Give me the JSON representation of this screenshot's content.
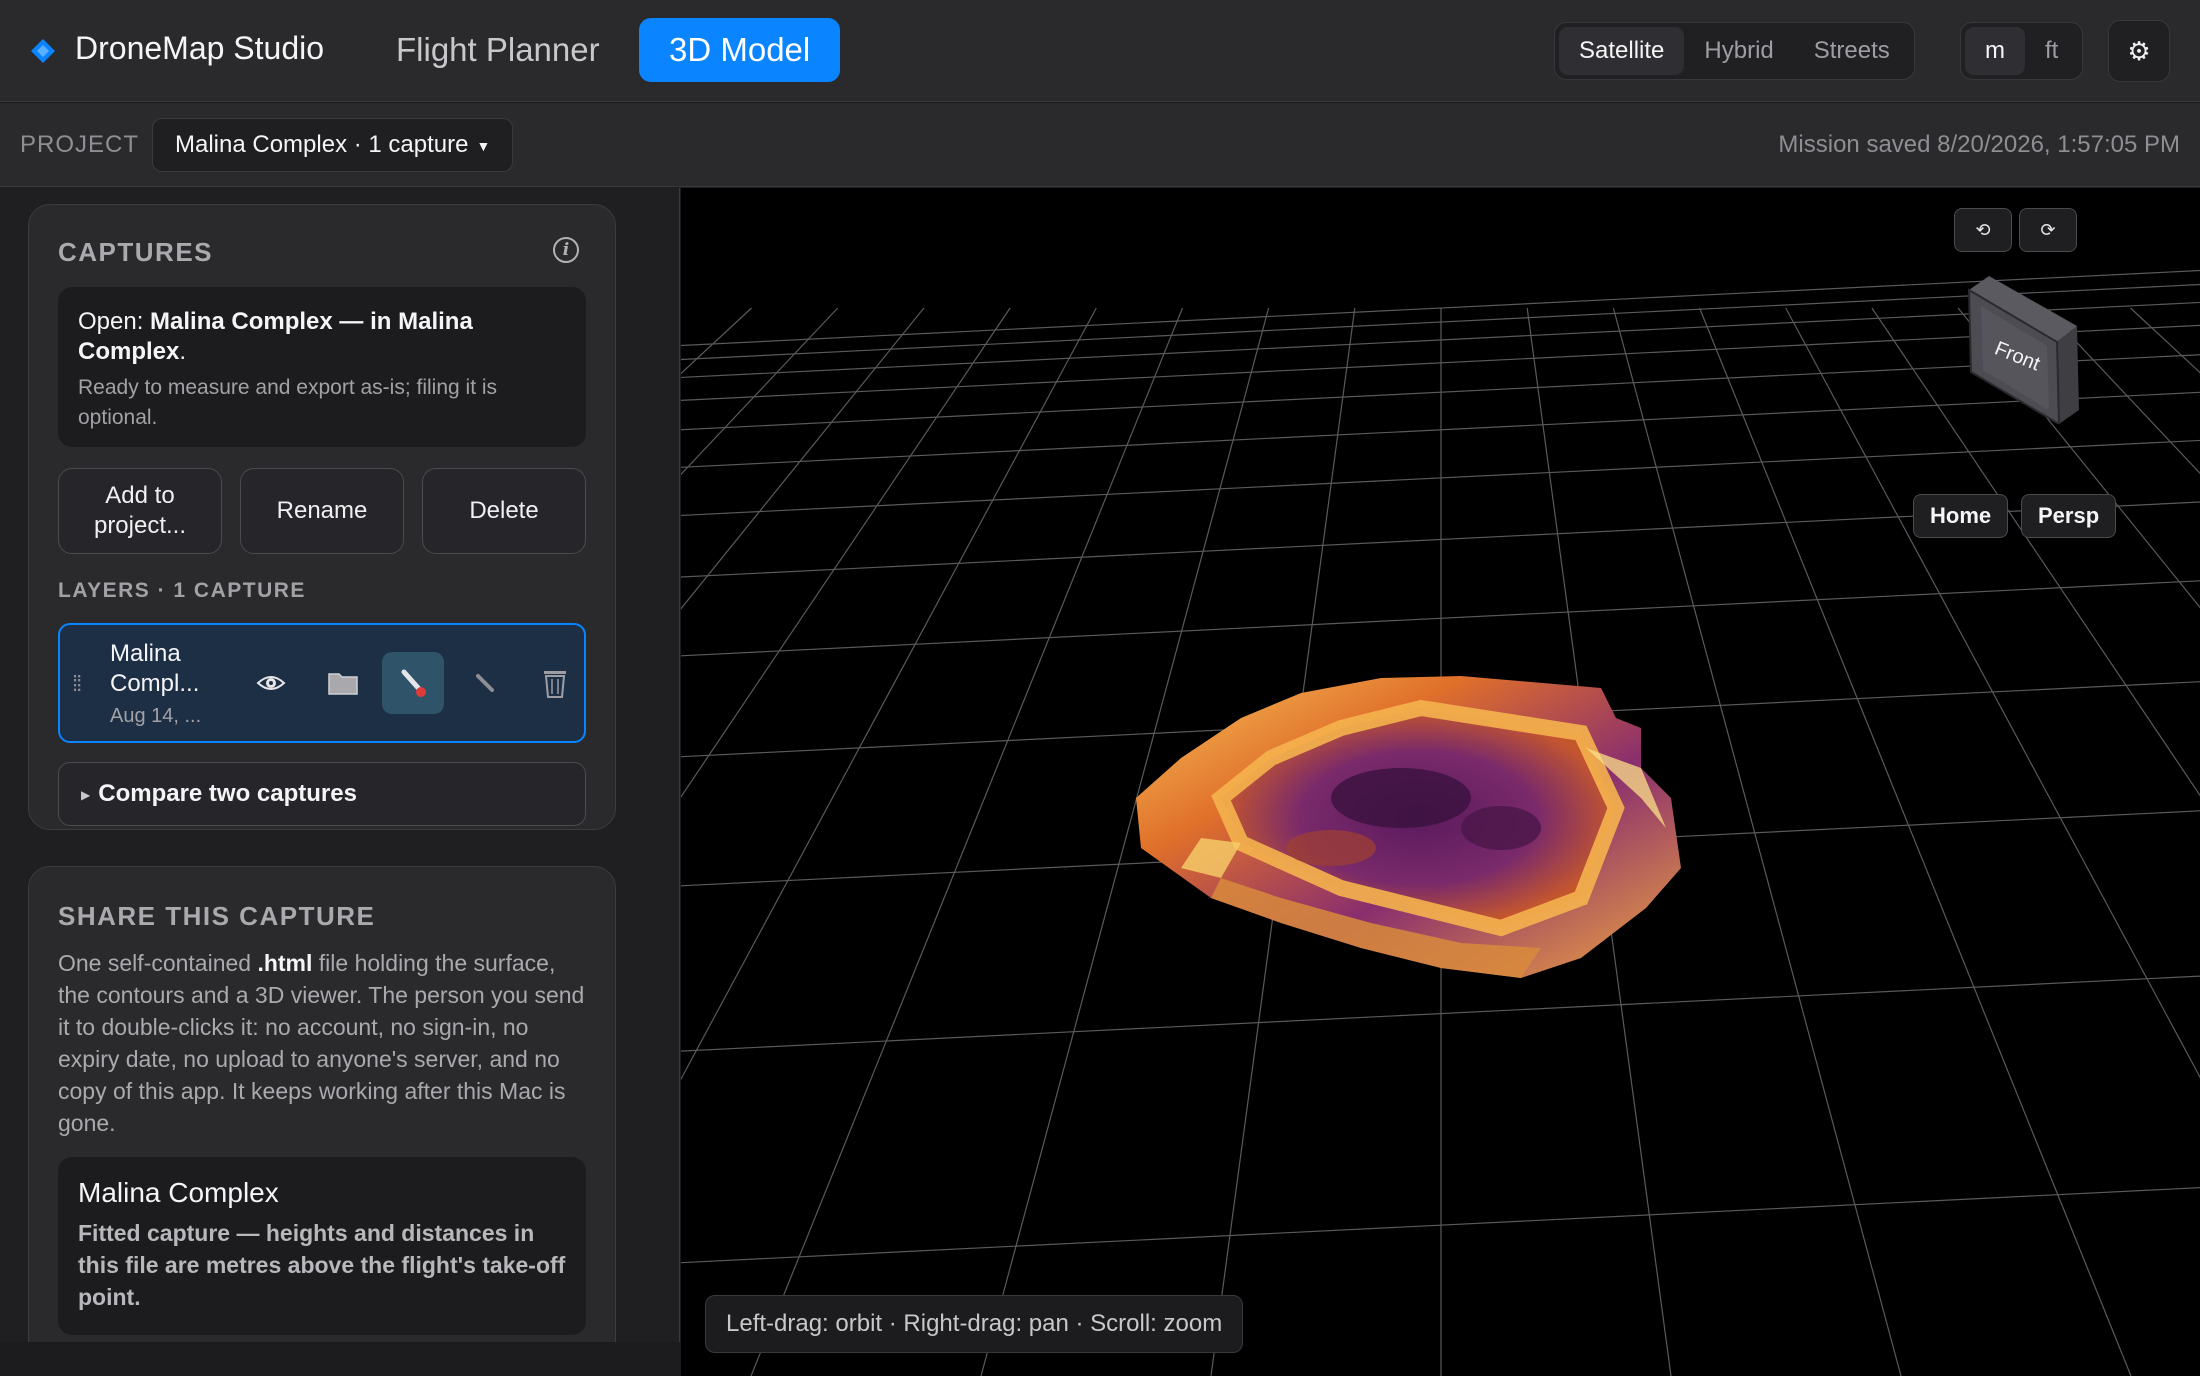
{
  "app": {
    "title": "DroneMap Studio",
    "accent": "#0a84ff",
    "nav": [
      {
        "label": "Flight Planner",
        "active": false
      },
      {
        "label": "3D Model",
        "active": true
      }
    ],
    "map_modes": [
      "Satellite",
      "Hybrid",
      "Streets"
    ],
    "map_mode_selected": "Satellite",
    "units": [
      "m",
      "ft"
    ],
    "unit_selected": "m",
    "settings_icon": "gear-icon"
  },
  "project_bar": {
    "label": "PROJECT",
    "selected": "Malina Complex · 1 capture",
    "saved_status": "Mission saved 8/20/2026, 1:57:05 PM"
  },
  "captures": {
    "heading": "CAPTURES",
    "open_prefix": "Open: ",
    "open_name": "Malina Complex",
    "open_mid": " — in ",
    "open_project": "Malina Complex",
    "open_suffix": ".",
    "open_note": "Ready to measure and export as-is; filing it is optional.",
    "buttons": {
      "add": "Add to project...",
      "rename": "Rename",
      "delete": "Delete"
    },
    "layers_heading": "LAYERS · 1 CAPTURE",
    "layers": [
      {
        "name": "Malina Compl...",
        "date": "Aug 14, ..."
      }
    ],
    "compare_label": "Compare two captures"
  },
  "share": {
    "heading": "SHARE THIS CAPTURE",
    "desc_pre": "One self-contained ",
    "desc_bold": ".html",
    "desc_post": " file holding the surface, the contours and a 3D viewer. The person you send it to double-clicks it: no account, no sign-in, no expiry date, no upload to anyone's server, and no copy of this app. It keeps working after this Mac is gone.",
    "card_title": "Malina Complex",
    "card_desc": "Fitted capture — heights and distances in this file are metres above the flight's take-off point."
  },
  "viewport": {
    "view_cube_label": "Front",
    "home_label": "Home",
    "persp_label": "Persp",
    "hint": "Left-drag: orbit · Right-drag: pan · Scroll: zoom"
  }
}
